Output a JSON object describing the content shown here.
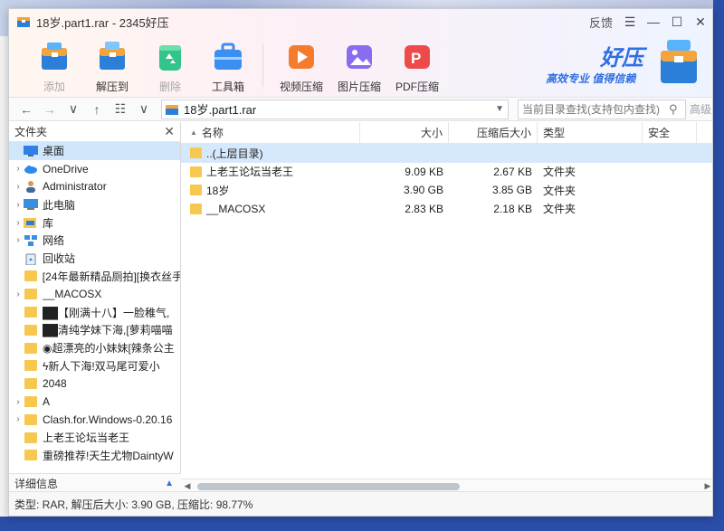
{
  "window": {
    "title": "18岁.part1.rar - 2345好压",
    "feedback": "反馈"
  },
  "toolbar": {
    "items": [
      {
        "label": "添加",
        "dim": true
      },
      {
        "label": "解压到",
        "dim": false
      },
      {
        "label": "删除",
        "dim": true
      },
      {
        "label": "工具箱",
        "dim": false
      },
      {
        "label": "视频压缩",
        "dim": false
      },
      {
        "label": "图片压缩",
        "dim": false
      },
      {
        "label": "PDF压缩",
        "dim": false
      }
    ]
  },
  "brand": {
    "name": "好压",
    "slogan": "高效专业 值得信赖"
  },
  "nav": {
    "path": "18岁.part1.rar",
    "search_placeholder": "当前目录查找(支持包内查找)",
    "advanced": "高级"
  },
  "left": {
    "header": "文件夹",
    "items": [
      {
        "label": "桌面",
        "arrow": "",
        "icon": "desktop"
      },
      {
        "label": "OneDrive",
        "arrow": "›",
        "icon": "cloud"
      },
      {
        "label": "Administrator",
        "arrow": "›",
        "icon": "user"
      },
      {
        "label": "此电脑",
        "arrow": "›",
        "icon": "computer"
      },
      {
        "label": "库",
        "arrow": "›",
        "icon": "library"
      },
      {
        "label": "网络",
        "arrow": "›",
        "icon": "network"
      },
      {
        "label": "回收站",
        "arrow": "",
        "icon": "recycle"
      },
      {
        "label": "[24年最新精品厕拍][换衣丝手",
        "arrow": "",
        "icon": "folder"
      },
      {
        "label": "__MACOSX",
        "arrow": "›",
        "icon": "folder"
      },
      {
        "label": "██【刚满十八】一脸稚气,",
        "arrow": "",
        "icon": "folder"
      },
      {
        "label": "██清纯学妹下海,[萝莉喵喵",
        "arrow": "",
        "icon": "folder"
      },
      {
        "label": "◉超漂亮的小妹妹[辣条公主",
        "arrow": "",
        "icon": "folder"
      },
      {
        "label": "ϟ新人下海!双马尾可爱小",
        "arrow": "",
        "icon": "folder"
      },
      {
        "label": "2048",
        "arrow": "",
        "icon": "folder"
      },
      {
        "label": "A",
        "arrow": "›",
        "icon": "folder"
      },
      {
        "label": "Clash.for.Windows-0.20.16",
        "arrow": "›",
        "icon": "folder"
      },
      {
        "label": "上老王论坛当老王",
        "arrow": "",
        "icon": "folder"
      },
      {
        "label": "重磅推荐!天生尤物DaintyW",
        "arrow": "",
        "icon": "folder"
      }
    ],
    "detail": "详细信息"
  },
  "columns": {
    "name": "名称",
    "size": "大小",
    "csize": "压缩后大小",
    "type": "类型",
    "security": "安全"
  },
  "files": [
    {
      "name": "..(上层目录)",
      "size": "",
      "csize": "",
      "type": "",
      "selected": true
    },
    {
      "name": "上老王论坛当老王",
      "size": "9.09 KB",
      "csize": "2.67 KB",
      "type": "文件夹",
      "selected": false
    },
    {
      "name": "18岁",
      "size": "3.90 GB",
      "csize": "3.85 GB",
      "type": "文件夹",
      "selected": false
    },
    {
      "name": "__MACOSX",
      "size": "2.83 KB",
      "csize": "2.18 KB",
      "type": "文件夹",
      "selected": false
    }
  ],
  "status": "类型: RAR, 解压后大小: 3.90 GB, 压缩比: 98.77%"
}
